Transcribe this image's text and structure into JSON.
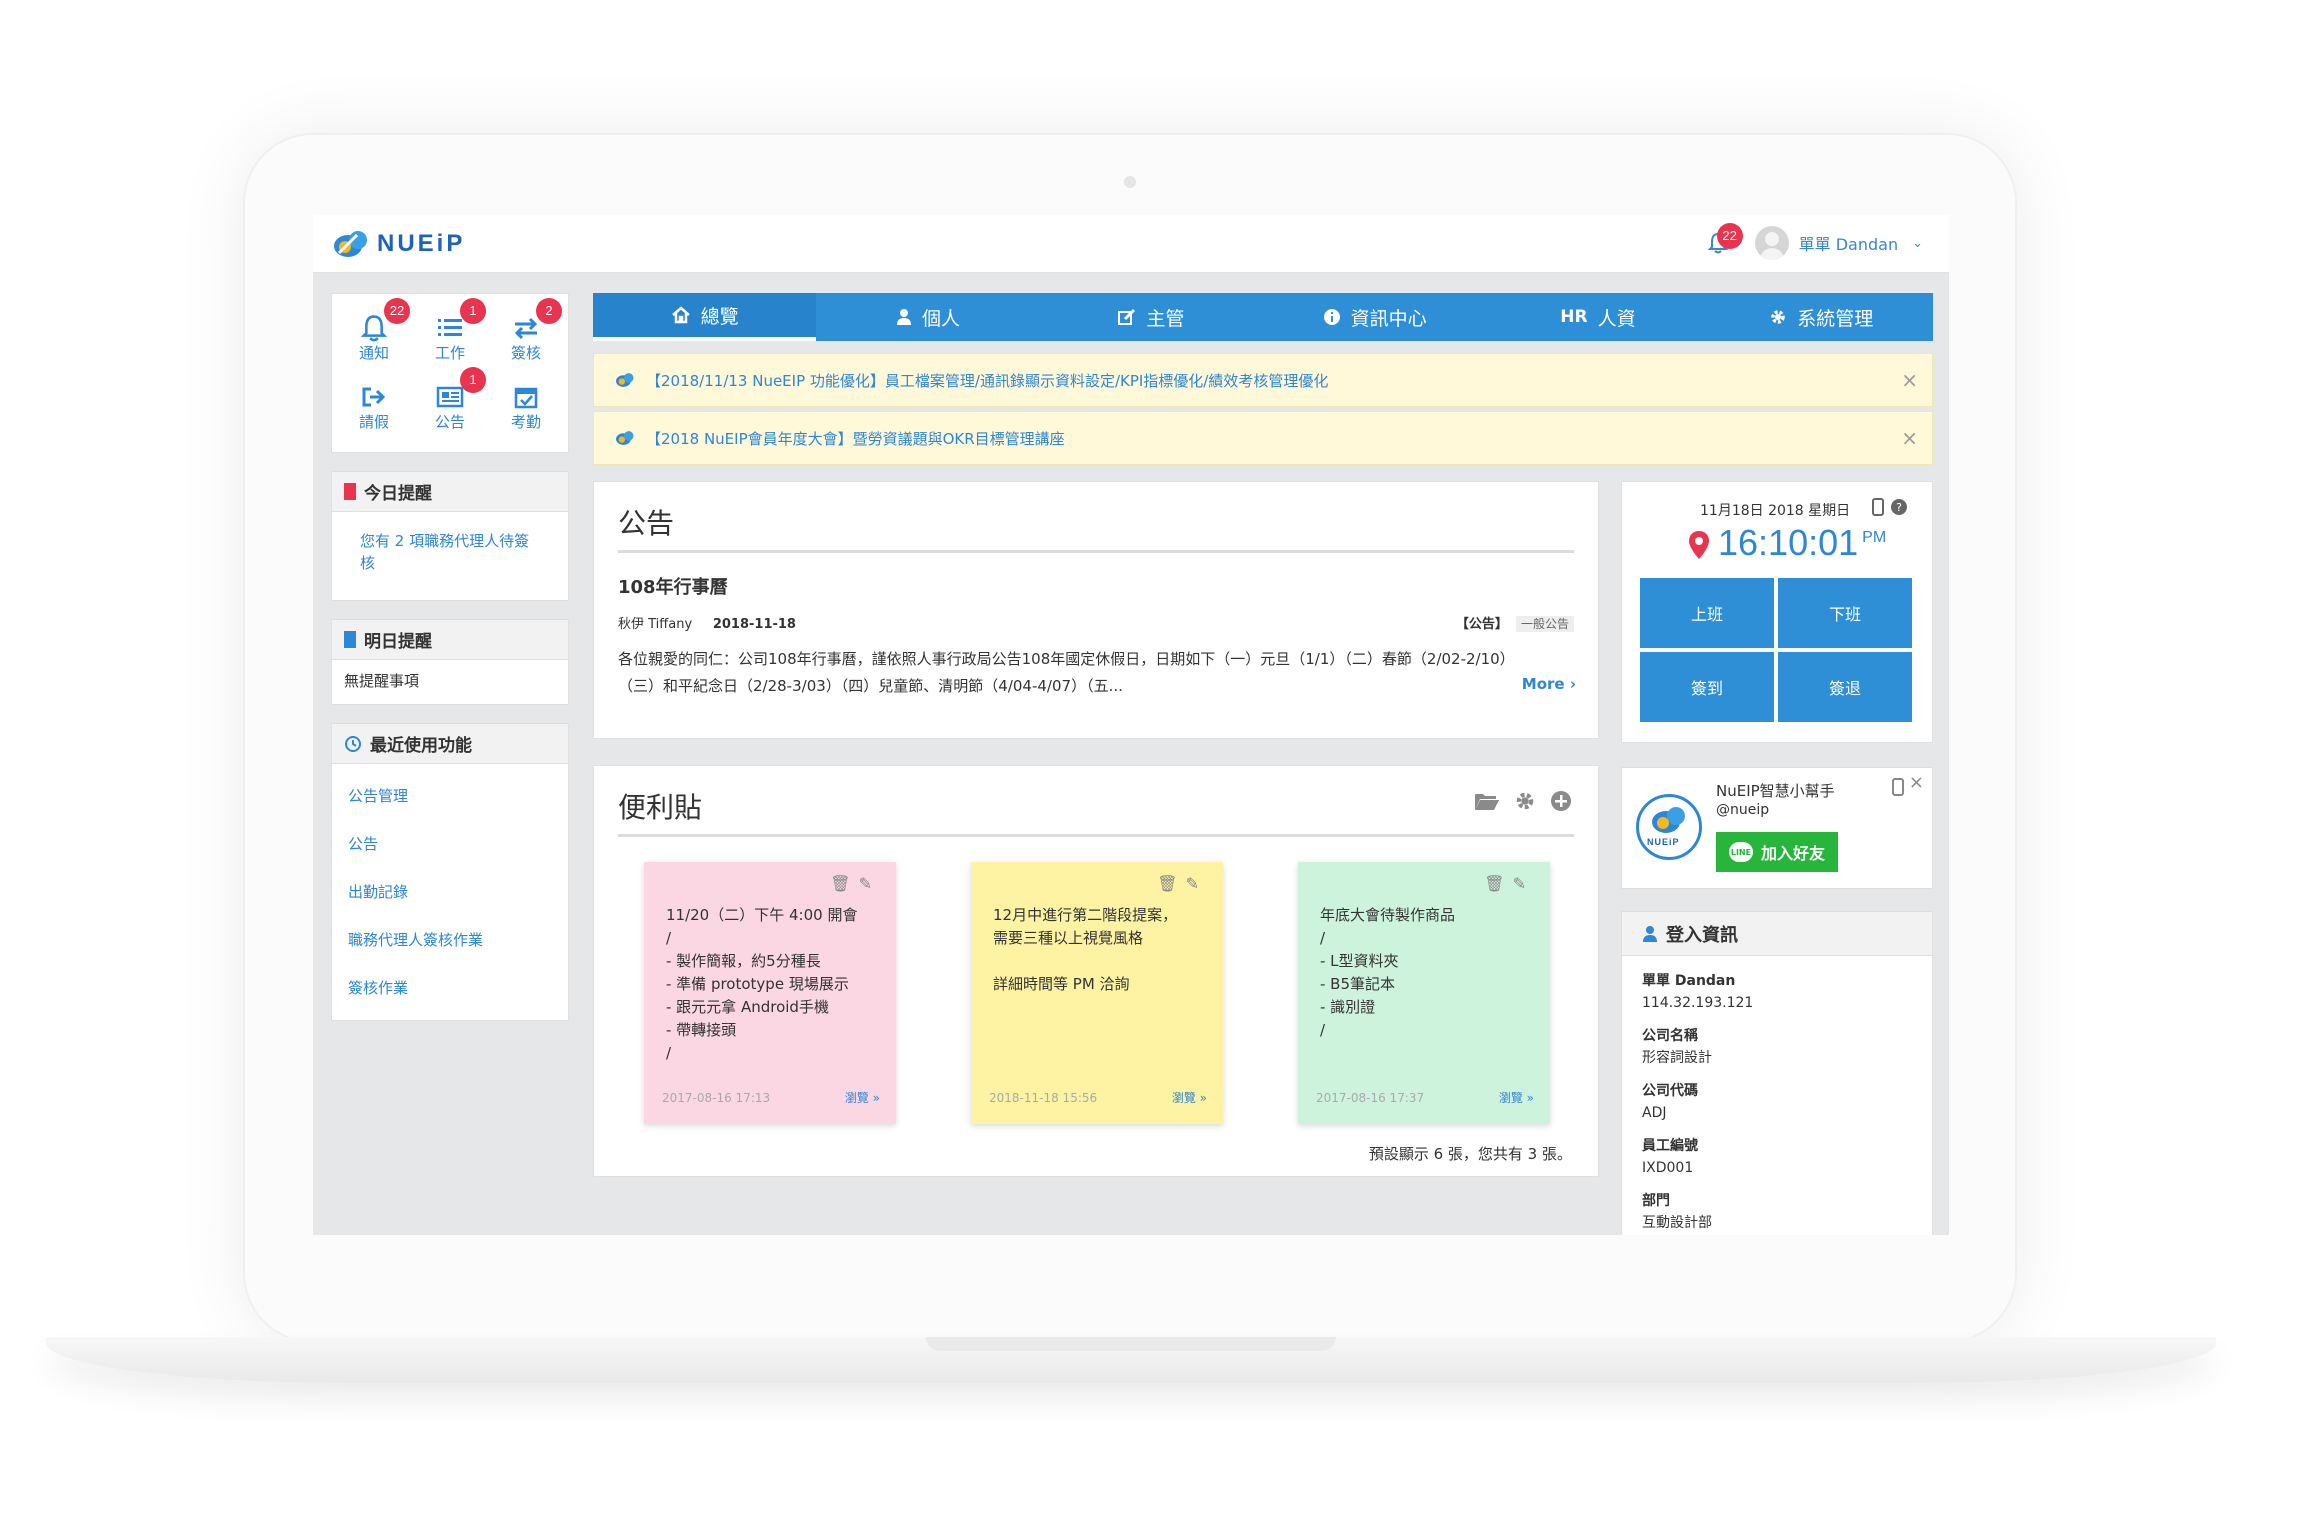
{
  "brand": {
    "name": "NUEiP"
  },
  "header": {
    "notification_count": "22",
    "user_name": "單單 Dandan"
  },
  "shortcuts": [
    {
      "label": "通知",
      "icon": "bell-icon",
      "badge": "22"
    },
    {
      "label": "工作",
      "icon": "list-icon",
      "badge": "1"
    },
    {
      "label": "簽核",
      "icon": "exchange-icon",
      "badge": "2"
    },
    {
      "label": "請假",
      "icon": "sign-out-icon",
      "badge": ""
    },
    {
      "label": "公告",
      "icon": "newspaper-icon",
      "badge": "1"
    },
    {
      "label": "考勤",
      "icon": "calendar-check-icon",
      "badge": ""
    }
  ],
  "today_reminder": {
    "title": "今日提醒",
    "text": "您有 2 項職務代理人待簽核"
  },
  "tomorrow_reminder": {
    "title": "明日提醒",
    "text": "無提醒事項"
  },
  "recent": {
    "title": "最近使用功能",
    "items": [
      "公告管理",
      "公告",
      "出勤記錄",
      "職務代理人簽核作業",
      "簽核作業"
    ]
  },
  "nav": [
    {
      "label": "總覽",
      "icon": "home-icon"
    },
    {
      "label": "個人",
      "icon": "user-icon"
    },
    {
      "label": "主管",
      "icon": "edit-icon"
    },
    {
      "label": "資訊中心",
      "icon": "info-icon"
    },
    {
      "label": "人資",
      "icon": "hr-icon",
      "prefix": "HR"
    },
    {
      "label": "系統管理",
      "icon": "gear-icon"
    }
  ],
  "alerts": [
    "【2018/11/13 NueEIP 功能優化】員工檔案管理/通訊錄顯示資料設定/KPI指標優化/績效考核管理優化",
    "【2018 NuEIP會員年度大會】暨勞資議題與OKR目標管理講座"
  ],
  "announcement": {
    "section_title": "公告",
    "title": "108年行事曆",
    "author": "秋伊 Tiffany",
    "date": "2018-11-18",
    "tag": "【公告】",
    "category": "一般公告",
    "body": "各位親愛的同仁：公司108年行事曆，謹依照人事行政局公告108年國定休假日，日期如下（一）元旦（1/1）（二）春節（2/02-2/10）（三）和平紀念日（2/28-3/03）（四）兒童節、清明節（4/04-4/07）（五...",
    "more": "More"
  },
  "stickies": {
    "section_title": "便利貼",
    "count_text": "預設顯示 6 張，您共有 3 張。",
    "view_label": "瀏覽 »",
    "notes": [
      {
        "color": "#fbd6e3",
        "text": "11/20（二）下午 4:00 開會\n/\n- 製作簡報，約5分種長\n- 準備 prototype 現場展示\n- 跟元元拿 Android手機\n- 帶轉接頭\n/",
        "date": "2017-08-16 17:13"
      },
      {
        "color": "#fdf3a3",
        "text": "12月中進行第二階段提案，\n需要三種以上視覺風格\n\n詳細時間等 PM 洽詢",
        "date": "2018-11-18 15:56"
      },
      {
        "color": "#cdf3dd",
        "text": "年底大會待製作商品\n/\n- L型資料夾\n- B5筆記本\n- 識別證\n/",
        "date": "2017-08-16 17:37"
      }
    ]
  },
  "clock": {
    "date": "11月18日 2018 星期日",
    "time": "16:10:01",
    "ampm": "PM",
    "buttons": [
      "上班",
      "下班",
      "簽到",
      "簽退"
    ]
  },
  "line": {
    "name": "NuEIP智慧小幫手",
    "id": "@nueip",
    "button": "加入好友",
    "logo_text": "NUEiP",
    "line_word": "LINE"
  },
  "login": {
    "title": "登入資訊",
    "fields": [
      {
        "label": "單單 Dandan",
        "value": "114.32.193.121"
      },
      {
        "label": "公司名稱",
        "value": "形容詞設計"
      },
      {
        "label": "公司代碼",
        "value": "ADJ"
      },
      {
        "label": "員工編號",
        "value": "IXD001"
      },
      {
        "label": "部門",
        "value": "互動設計部"
      }
    ]
  },
  "colors": {
    "primary": "#2e8ed6",
    "badge": "#e8344f",
    "alert_bg": "#fff9d9",
    "line_green": "#27b53c"
  }
}
